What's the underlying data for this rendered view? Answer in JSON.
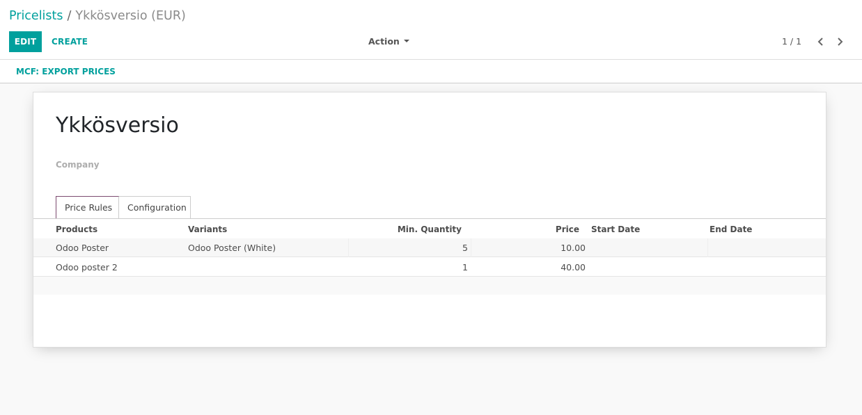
{
  "breadcrumb": {
    "parent": "Pricelists",
    "separator": "/",
    "current": "Ykkösversio (EUR)"
  },
  "toolbar": {
    "edit_label": "EDIT",
    "create_label": "CREATE",
    "action_label": "Action"
  },
  "pager": {
    "value": "1 / 1",
    "prev_icon": "chevron-left-icon",
    "next_icon": "chevron-right-icon"
  },
  "statusbar": {
    "export_label": "MCF: EXPORT PRICES"
  },
  "record": {
    "name": "Ykkösversio",
    "company_label": "Company",
    "company_value": ""
  },
  "tabs": [
    {
      "label": "Price Rules",
      "active": true
    },
    {
      "label": "Configuration",
      "active": false
    }
  ],
  "table": {
    "columns": [
      "Products",
      "Variants",
      "Min. Quantity",
      "Price",
      "Start Date",
      "End Date"
    ],
    "rows": [
      {
        "product": "Odoo Poster",
        "variant": "Odoo Poster (White)",
        "min_qty": "5",
        "price": "10.00",
        "start": "",
        "end": ""
      },
      {
        "product": "Odoo poster 2",
        "variant": "",
        "min_qty": "1",
        "price": "40.00",
        "start": "",
        "end": ""
      }
    ]
  },
  "colors": {
    "accent": "#00a09d",
    "tab_accent": "#7c4a6f"
  }
}
